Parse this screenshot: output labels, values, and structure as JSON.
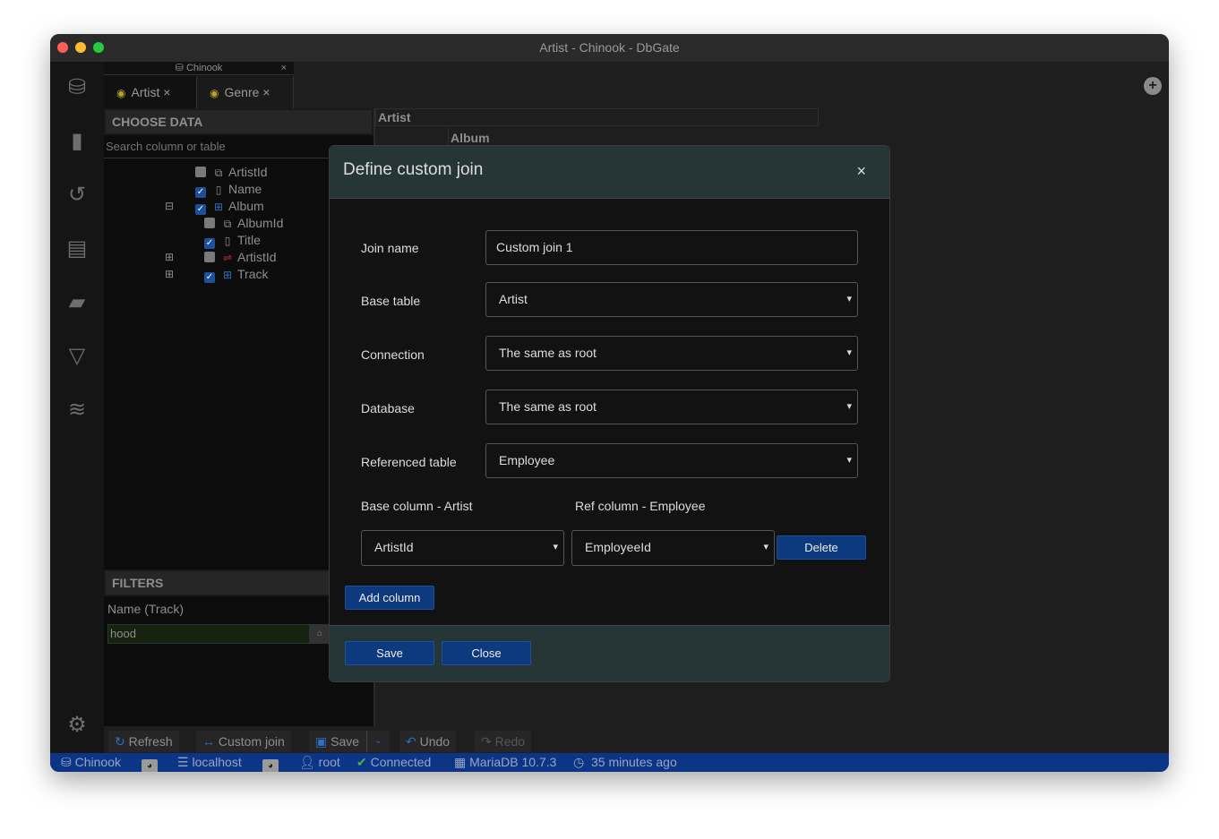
{
  "window": {
    "title": "Artist - Chinook - DbGate"
  },
  "sidebar": {
    "icons": [
      "database-icon",
      "file-icon",
      "history-icon",
      "archive-icon",
      "plugin-icon",
      "filter-icon",
      "layers-icon",
      "gear-icon"
    ]
  },
  "tabs": {
    "group": "Chinook",
    "items": [
      {
        "label": "Artist",
        "active": true
      },
      {
        "label": "Genre",
        "active": false
      }
    ]
  },
  "choose_data": {
    "title": "CHOOSE DATA",
    "search_placeholder": "Search column or table",
    "tree": [
      {
        "label": "ArtistId",
        "checked": false,
        "icon": "primary-key-icon"
      },
      {
        "label": "Name",
        "checked": true,
        "icon": "column-icon"
      },
      {
        "label": "Album",
        "checked": true,
        "icon": "table-icon",
        "expanded": true
      },
      {
        "label": "AlbumId",
        "checked": false,
        "icon": "primary-key-icon"
      },
      {
        "label": "Title",
        "checked": true,
        "icon": "column-icon"
      },
      {
        "label": "ArtistId",
        "checked": false,
        "icon": "foreign-key-icon"
      },
      {
        "label": "Track",
        "checked": true,
        "icon": "table-icon"
      }
    ]
  },
  "filters": {
    "title": "FILTERS",
    "field_label": "Name (Track)",
    "value": "hood"
  },
  "grid": {
    "header1": "Artist",
    "header2": "Album"
  },
  "dialog": {
    "title": "Define custom join",
    "join_name_label": "Join name",
    "join_name": "Custom join 1",
    "base_table_label": "Base table",
    "base_table": "Artist",
    "connection_label": "Connection",
    "connection": "The same as root",
    "database_label": "Database",
    "database": "The same as root",
    "ref_table_label": "Referenced table",
    "ref_table": "Employee",
    "base_column_header": "Base column - Artist",
    "ref_column_header": "Ref column - Employee",
    "base_column": "ArtistId",
    "ref_column": "EmployeeId",
    "delete": "Delete",
    "add_column": "Add column",
    "save": "Save",
    "close": "Close"
  },
  "toolbar": {
    "refresh": "Refresh",
    "custom_join": "Custom join",
    "save": "Save",
    "undo": "Undo",
    "redo": "Redo"
  },
  "status": {
    "database": "Chinook",
    "server": "localhost",
    "user": "root",
    "connection": "Connected",
    "engine": "MariaDB 10.7.3",
    "time": "35 minutes ago"
  },
  "colors": {
    "accent": "#0d3a7e",
    "status_bar": "#0c3586",
    "dialog_header": "#263535"
  }
}
